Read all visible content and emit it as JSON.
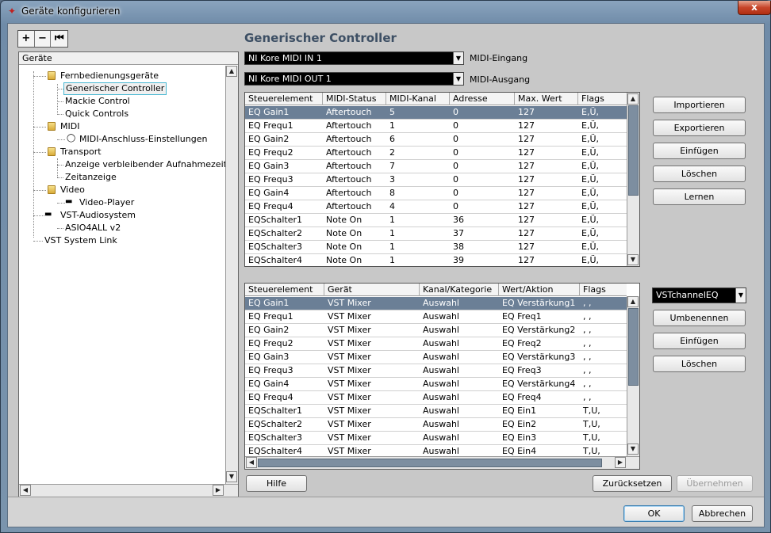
{
  "window": {
    "title": "Geräte konfigurieren",
    "close_label": "x"
  },
  "toolbar": {
    "add_label": "+",
    "remove_label": "−",
    "reset_label": "⏮"
  },
  "tree": {
    "header": "Geräte",
    "nodes": {
      "fernbedienung": "Fernbedienungsgeräte",
      "generischer": "Generischer Controller",
      "mackie": "Mackie Control",
      "quick": "Quick Controls",
      "midi": "MIDI",
      "midi_anschluss": "MIDI-Anschluss-Einstellungen",
      "transport": "Transport",
      "anzeige": "Anzeige verbleibender Aufnahmezeit",
      "zeitanzeige": "Zeitanzeige",
      "video": "Video",
      "video_player": "Video-Player",
      "vst_audio": "VST-Audiosystem",
      "asio": "ASIO4ALL v2",
      "vst_link": "VST System Link"
    }
  },
  "main": {
    "title": "Generischer Controller",
    "midi_in": {
      "value": "NI Kore MIDI IN 1",
      "label": "MIDI-Eingang"
    },
    "midi_out": {
      "value": "NI Kore MIDI OUT 1",
      "label": "MIDI-Ausgang"
    }
  },
  "table1": {
    "headers": [
      "Steuerelement",
      "MIDI-Status",
      "MIDI-Kanal",
      "Adresse",
      "Max. Wert",
      "Flags"
    ],
    "rows": [
      [
        "EQ Gain1",
        "Aftertouch",
        "5",
        "0",
        "127",
        "E,Ü,"
      ],
      [
        "EQ Frequ1",
        "Aftertouch",
        "1",
        "0",
        "127",
        "E,Ü,"
      ],
      [
        "EQ Gain2",
        "Aftertouch",
        "6",
        "0",
        "127",
        "E,Ü,"
      ],
      [
        "EQ Frequ2",
        "Aftertouch",
        "2",
        "0",
        "127",
        "E,Ü,"
      ],
      [
        "EQ Gain3",
        "Aftertouch",
        "7",
        "0",
        "127",
        "E,Ü,"
      ],
      [
        "EQ Frequ3",
        "Aftertouch",
        "3",
        "0",
        "127",
        "E,Ü,"
      ],
      [
        "EQ Gain4",
        "Aftertouch",
        "8",
        "0",
        "127",
        "E,Ü,"
      ],
      [
        "EQ Frequ4",
        "Aftertouch",
        "4",
        "0",
        "127",
        "E,Ü,"
      ],
      [
        "EQSchalter1",
        "Note On",
        "1",
        "36",
        "127",
        "E,Ü,"
      ],
      [
        "EQSchalter2",
        "Note On",
        "1",
        "37",
        "127",
        "E,Ü,"
      ],
      [
        "EQSchalter3",
        "Note On",
        "1",
        "38",
        "127",
        "E,Ü,"
      ],
      [
        "EQSchalter4",
        "Note On",
        "1",
        "39",
        "127",
        "E,Ü,"
      ]
    ]
  },
  "table2": {
    "headers": [
      "Steuerelement",
      "Gerät",
      "Kanal/Kategorie",
      "Wert/Aktion",
      "Flags"
    ],
    "rows": [
      [
        "EQ Gain1",
        "VST Mixer",
        "Auswahl",
        "EQ Verstärkung1",
        ", ,"
      ],
      [
        "EQ Frequ1",
        "VST Mixer",
        "Auswahl",
        "EQ Freq1",
        ", ,"
      ],
      [
        "EQ Gain2",
        "VST Mixer",
        "Auswahl",
        "EQ Verstärkung2",
        ", ,"
      ],
      [
        "EQ Frequ2",
        "VST Mixer",
        "Auswahl",
        "EQ Freq2",
        ", ,"
      ],
      [
        "EQ Gain3",
        "VST Mixer",
        "Auswahl",
        "EQ Verstärkung3",
        ", ,"
      ],
      [
        "EQ Frequ3",
        "VST Mixer",
        "Auswahl",
        "EQ Freq3",
        ", ,"
      ],
      [
        "EQ Gain4",
        "VST Mixer",
        "Auswahl",
        "EQ Verstärkung4",
        ", ,"
      ],
      [
        "EQ Frequ4",
        "VST Mixer",
        "Auswahl",
        "EQ Freq4",
        ", ,"
      ],
      [
        "EQSchalter1",
        "VST Mixer",
        "Auswahl",
        "EQ Ein1",
        "T,U,"
      ],
      [
        "EQSchalter2",
        "VST Mixer",
        "Auswahl",
        "EQ Ein2",
        "T,U,"
      ],
      [
        "EQSchalter3",
        "VST Mixer",
        "Auswahl",
        "EQ Ein3",
        "T,U,"
      ],
      [
        "EQSchalter4",
        "VST Mixer",
        "Auswahl",
        "EQ Ein4",
        "T,U,"
      ]
    ]
  },
  "buttons_top": {
    "importieren": "Importieren",
    "exportieren": "Exportieren",
    "einfuegen": "Einfügen",
    "loeschen": "Löschen",
    "lernen": "Lernen"
  },
  "bank": {
    "value": "VSTchannelEQ"
  },
  "buttons_bottom": {
    "umbenennen": "Umbenennen",
    "einfuegen": "Einfügen",
    "loeschen": "Löschen"
  },
  "footer": {
    "hilfe": "Hilfe",
    "zuruecksetzen": "Zurücksetzen",
    "uebernehmen": "Übernehmen",
    "ok": "OK",
    "abbrechen": "Abbrechen"
  },
  "colors": {
    "selection": "#6b7f96",
    "title_accent": "#3d4f64"
  }
}
